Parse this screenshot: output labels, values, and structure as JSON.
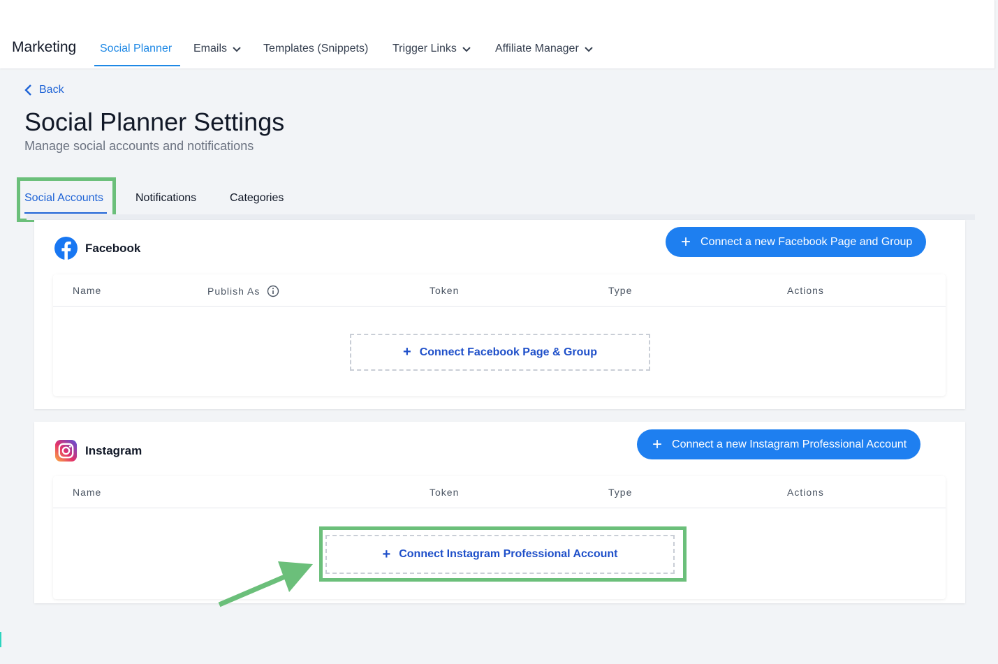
{
  "topnav": {
    "brand": "Marketing",
    "items": [
      {
        "label": "Social Planner",
        "active": true
      },
      {
        "label": "Emails",
        "dropdown": true
      },
      {
        "label": "Templates (Snippets)"
      },
      {
        "label": "Trigger Links",
        "dropdown": true
      },
      {
        "label": "Affiliate Manager",
        "dropdown": true
      }
    ]
  },
  "header": {
    "back_label": "Back",
    "title": "Social Planner Settings",
    "subtitle": "Manage social accounts and notifications"
  },
  "tabs": [
    {
      "label": "Social Accounts",
      "active": true
    },
    {
      "label": "Notifications"
    },
    {
      "label": "Categories"
    }
  ],
  "facebook": {
    "name": "Facebook",
    "connect_new_label": "Connect a new Facebook Page and Group",
    "columns": [
      "Name",
      "Publish As",
      "Token",
      "Type",
      "Actions"
    ],
    "empty_connect_label": "Connect Facebook Page & Group"
  },
  "instagram": {
    "name": "Instagram",
    "connect_new_label": "Connect a new Instagram Professional Account",
    "columns": [
      "Name",
      "Token",
      "Type",
      "Actions"
    ],
    "empty_connect_label": "Connect Instagram Professional Account"
  },
  "colors": {
    "accent": "#1e7ff0",
    "link": "#1e63d6",
    "highlight": "#6bbf7a",
    "facebook": "#1877f2"
  }
}
